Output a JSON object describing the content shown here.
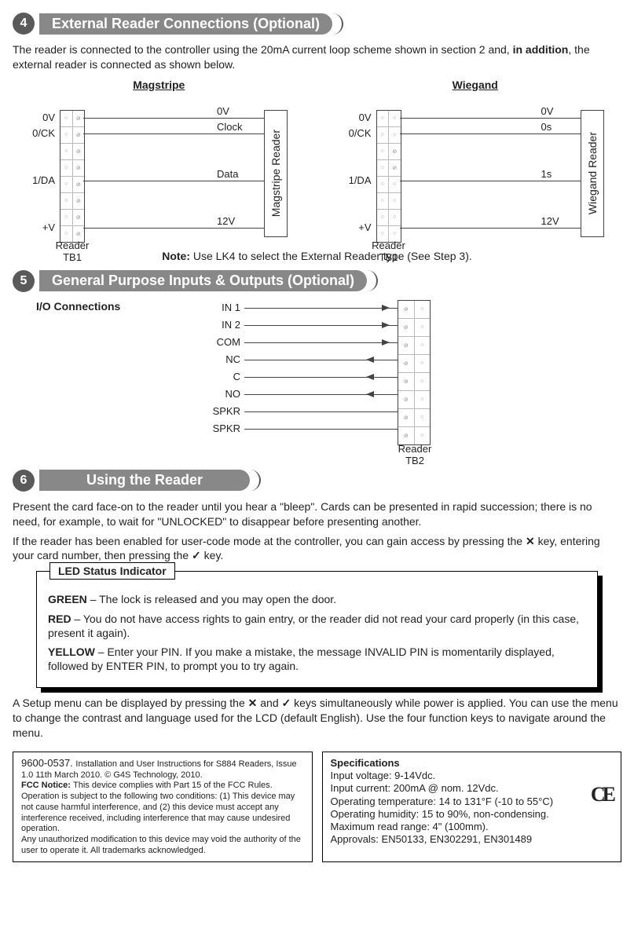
{
  "section4": {
    "num": "4",
    "title": "External Reader Connections (Optional)",
    "para": "The reader is connected to the controller using the 20mA current loop scheme shown in section 2 and, ",
    "para_bold": "in addition",
    "para_tail": ", the external reader is connected as shown below.",
    "magstripe": {
      "title": "Magstripe",
      "left": [
        "0V",
        "0/CK",
        "1/DA",
        "+V"
      ],
      "right": [
        "0V",
        "Clock",
        "Data",
        "12V"
      ],
      "reader": "Magstripe Reader",
      "tb": "Reader\nTB1"
    },
    "wiegand": {
      "title": "Wiegand",
      "left": [
        "0V",
        "0/CK",
        "1/DA",
        "+V"
      ],
      "right": [
        "0V",
        "0s",
        "1s",
        "12V"
      ],
      "reader": "Wiegand Reader",
      "tb": "Reader\nTB1"
    },
    "note_b": "Note: ",
    "note": "Use LK4 to select the External Reader type (See Step 3)."
  },
  "section5": {
    "num": "5",
    "title": "General Purpose Inputs & Outputs (Optional)",
    "io_title": "I/O Connections",
    "io": [
      "IN 1",
      "IN 2",
      "COM",
      "NC",
      "C",
      "NO",
      "SPKR",
      "SPKR"
    ],
    "tb": "Reader\nTB2"
  },
  "section6": {
    "num": "6",
    "title": "Using the Reader",
    "p1": "Present the card face-on to the reader until you hear a \"bleep\". Cards can be presented in rapid succession; there is no need, for example, to wait for \"UNLOCKED\" to disappear before presenting another.",
    "p2a": "If the reader has been enabled for user-code mode at the controller, you can gain access by pressing the ",
    "p2b": " key, entering your card number, then pressing the ",
    "p2c": " key.",
    "x_key": "✕",
    "check_key": "✓",
    "led": {
      "title": "LED Status Indicator",
      "green_b": "GREEN",
      "green": " – The lock is released and you may open the door.",
      "red_b": "RED",
      "red": " – You do not have access rights to gain entry, or the reader did not read your card properly (in this case, present it again).",
      "yellow_b": "YELLOW",
      "yellow": " – Enter your PIN. If you make a mistake, the message INVALID PIN is momentarily displayed, followed by ENTER PIN, to prompt you to try again."
    },
    "p3a": "A Setup menu can be displayed by pressing the ",
    "p3b": " and ",
    "p3c": " keys simultaneously while power is applied. You can use the menu to change the contrast and language used for the LCD (default English). Use the four function keys to navigate around the menu."
  },
  "footer": {
    "left": {
      "l1": "9600-0537. ",
      "l1b": "Installation and User Instructions for S884 Readers, Issue 1.0 11th March 2010. © G4S Technology, 2010.",
      "l2b": "FCC Notice: ",
      "l2": "This device complies with Part 15 of the FCC Rules. Operation is subject to the following two conditions: (1) This device may not cause harmful interference, and (2) this device must accept any interference received, including interference that may cause undesired operation.",
      "l3": "Any unauthorized modification to this device may void the authority of the user to operate it. All trademarks acknowledged."
    },
    "right": {
      "title": "Specifications",
      "s1": "Input voltage: 9-14Vdc.",
      "s2": "Input current:  200mA @ nom. 12Vdc.",
      "s3": "Operating temperature: 14 to 131°F (-10 to 55°C)",
      "s4": "Operating humidity: 15 to 90%, non-condensing.",
      "s5": "Maximum read range: 4\" (100mm).",
      "s6": "Approvals: EN50133, EN302291, EN301489"
    }
  }
}
